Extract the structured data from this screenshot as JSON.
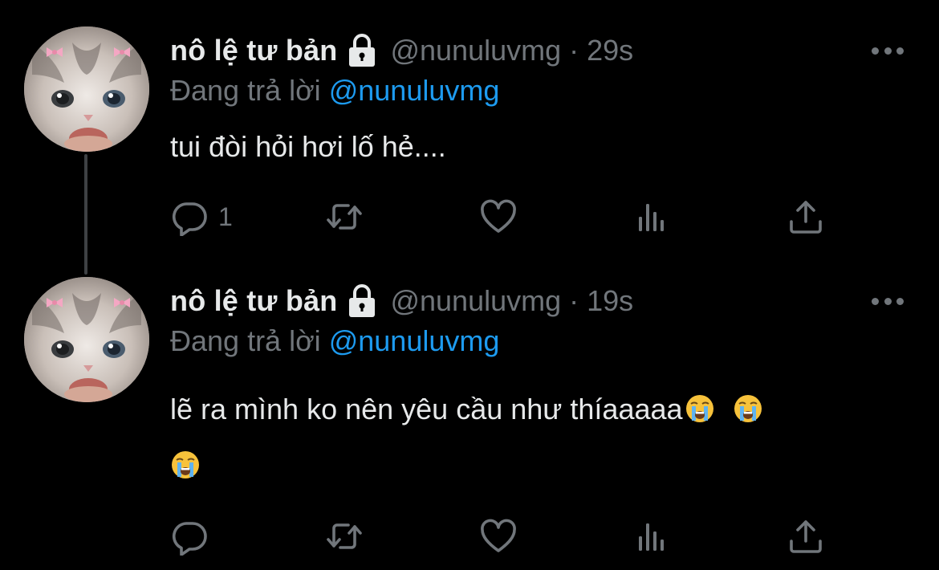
{
  "tweets": [
    {
      "display_name": "nô lệ tư bản",
      "handle": "@nunuluvmg",
      "separator": "·",
      "time": "29s",
      "reply_prefix": "Đang trả lời",
      "reply_to": "@nunuluvmg",
      "text": "tui đòi hỏi hơi lố hẻ....",
      "reply_count": "1",
      "retweet_count": "",
      "like_count": "",
      "view_count": ""
    },
    {
      "display_name": "nô lệ tư bản",
      "handle": "@nunuluvmg",
      "separator": "·",
      "time": "19s",
      "reply_prefix": "Đang trả lời",
      "reply_to": "@nunuluvmg",
      "text": "lẽ ra mình ko nên yêu cầu như thíaaaaa",
      "reply_count": "",
      "retweet_count": "",
      "like_count": "",
      "view_count": ""
    }
  ],
  "colors": {
    "background": "#000000",
    "text_primary": "#e7e9ea",
    "text_secondary": "#71767b",
    "accent_link": "#1d9bf0",
    "thread_line": "#3e4144"
  },
  "icons": {
    "lock": "lock-icon",
    "more": "more-dots-icon",
    "reply": "reply-bubble-icon",
    "retweet": "retweet-icon",
    "like": "heart-icon",
    "views": "views-bar-chart-icon",
    "share": "share-upload-icon",
    "emoji": "loudly-crying-face-emoji",
    "avatar": "kitten-avatar-with-pink-bows"
  }
}
